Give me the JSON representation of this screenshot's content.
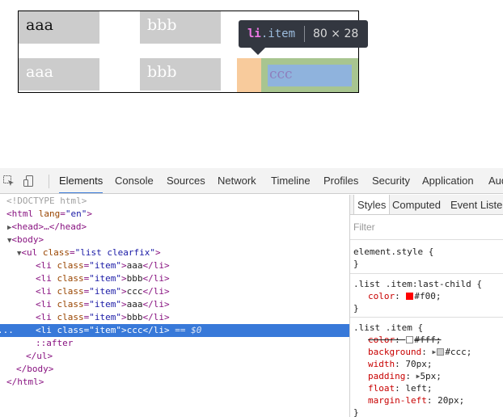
{
  "preview": {
    "row1": [
      "aaa",
      "bbb"
    ],
    "row2": [
      "aaa",
      "bbb",
      "ccc"
    ]
  },
  "tooltip": {
    "tag": "li",
    "cls": ".item",
    "dims": "80 × 28"
  },
  "toolbar": {
    "tabs": [
      "Elements",
      "Console",
      "Sources",
      "Network",
      "Timeline",
      "Profiles",
      "Security",
      "Application",
      "Audits"
    ]
  },
  "elements_tree": {
    "doctype": "<!DOCTYPE html>",
    "html_open": "<html",
    "lang_attr": "lang",
    "lang_val": "\"en\"",
    "close_bracket": ">",
    "head": "<head>…</head>",
    "body_open": "<body>",
    "ul_open": "<ul",
    "class_attr": "class",
    "ul_class": "\"list clearfix\"",
    "li_open": "<li",
    "item_class": "\"item\"",
    "li_close": "</li>",
    "items": [
      "aaa",
      "bbb",
      "ccc",
      "aaa",
      "bbb",
      "ccc"
    ],
    "selected_suffix": " == $0",
    "after": "::after",
    "ul_close": "</ul>",
    "body_close": "</body>",
    "html_close": "</html>",
    "ellipsis": "..."
  },
  "styles_panel": {
    "tabs": [
      "Styles",
      "Computed",
      "Event Listeners"
    ],
    "filter_placeholder": "Filter",
    "rule0": {
      "selector": "element.style {",
      "close": "}"
    },
    "rule1": {
      "selector": ".list .item:last-child {",
      "color_name": "color",
      "color_value": "#f00;",
      "close": "}"
    },
    "rule2": {
      "selector": ".list .item {",
      "props": [
        {
          "name": "color",
          "value": "#fff;"
        },
        {
          "name": "background",
          "value": "#ccc;"
        },
        {
          "name": "width",
          "value": "70px;"
        },
        {
          "name": "padding",
          "value": "5px;"
        },
        {
          "name": "float",
          "value": "left;"
        },
        {
          "name": "margin-left",
          "value": "20px;"
        }
      ],
      "close": "}"
    },
    "colon": ": "
  },
  "colors": {
    "red_swatch": "#ff0000",
    "white_swatch": "#ffffff",
    "gray_swatch": "#cccccc",
    "selection": "#3879d9"
  }
}
